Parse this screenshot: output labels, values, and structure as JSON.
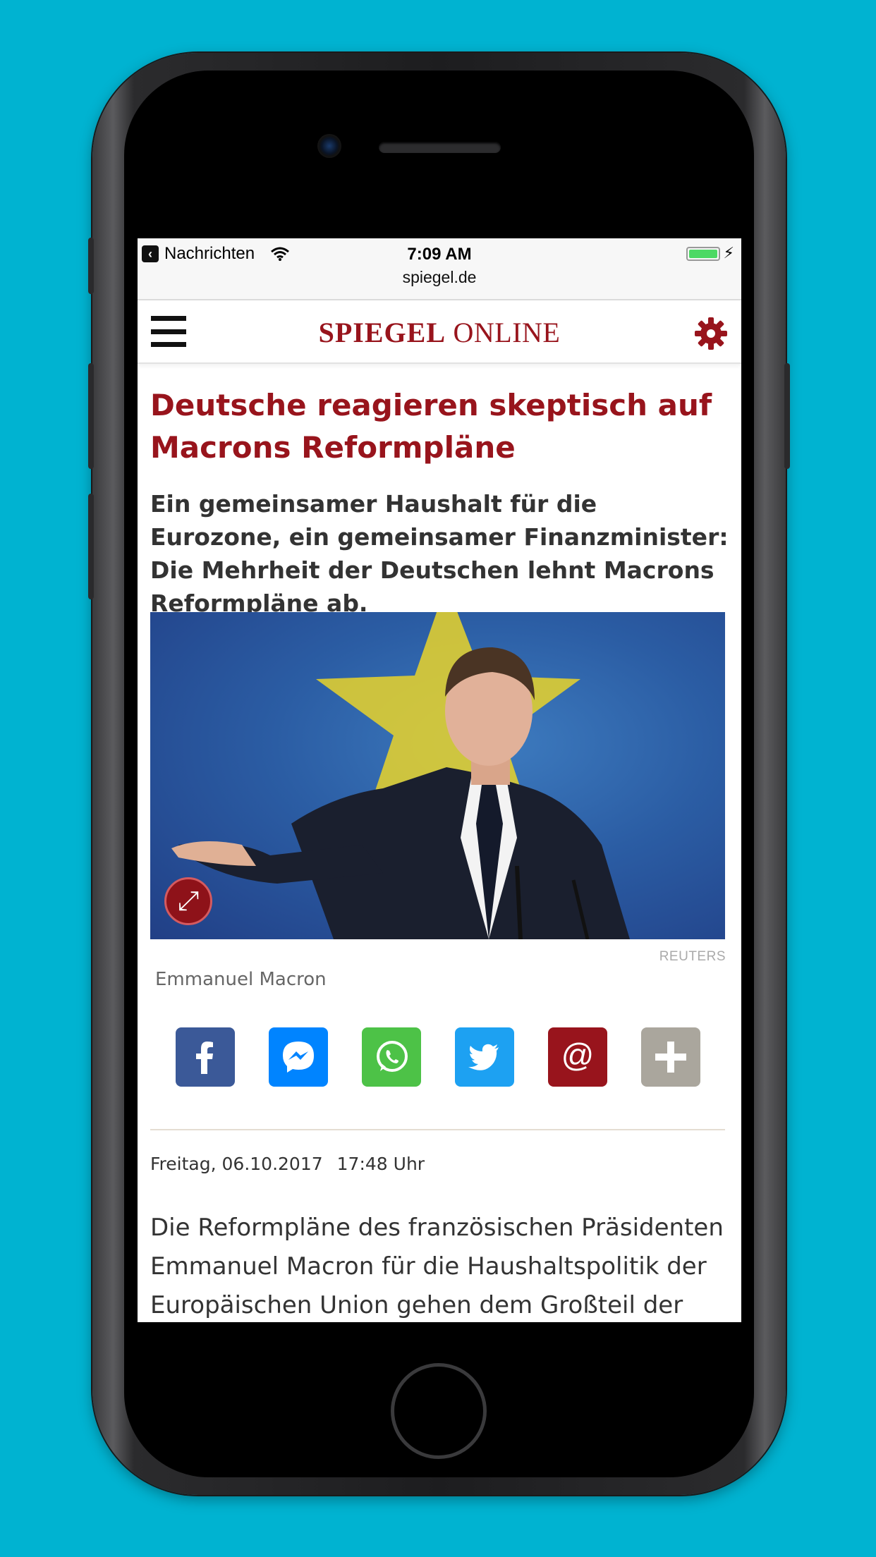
{
  "status_bar": {
    "back_app": "Nachrichten",
    "time": "7:09 AM",
    "url": "spiegel.de"
  },
  "header": {
    "logo_bold": "SPIEGEL",
    "logo_light": "ONLINE",
    "brand_color": "#98141c"
  },
  "article": {
    "headline": "Deutsche reagieren skeptisch auf Macrons Reformpläne",
    "intro": "Ein gemeinsamer Haushalt für die Eurozone, ein gemeinsamer Finanzminister: Die Mehrheit der Deutschen lehnt Macrons Reformpläne ab.",
    "image_credit": "REUTERS",
    "image_caption": "Emmanuel Macron",
    "date": "Freitag, 06.10.2017",
    "time": "17:48 Uhr",
    "body": "Die Reformpläne des französischen Präsidenten Emmanuel Macron für die Haushaltspolitik der Europäischen Union gehen dem Großteil der"
  },
  "share_buttons": [
    {
      "icon": "facebook-icon",
      "color": "#3b5998"
    },
    {
      "icon": "messenger-icon",
      "color": "#0084ff"
    },
    {
      "icon": "whatsapp-icon",
      "color": "#4dc247"
    },
    {
      "icon": "twitter-icon",
      "color": "#1da1f2"
    },
    {
      "icon": "email-icon",
      "color": "#98141c"
    },
    {
      "icon": "plus-icon",
      "color": "#aaa69d"
    }
  ],
  "background_color": "#00b3d1"
}
